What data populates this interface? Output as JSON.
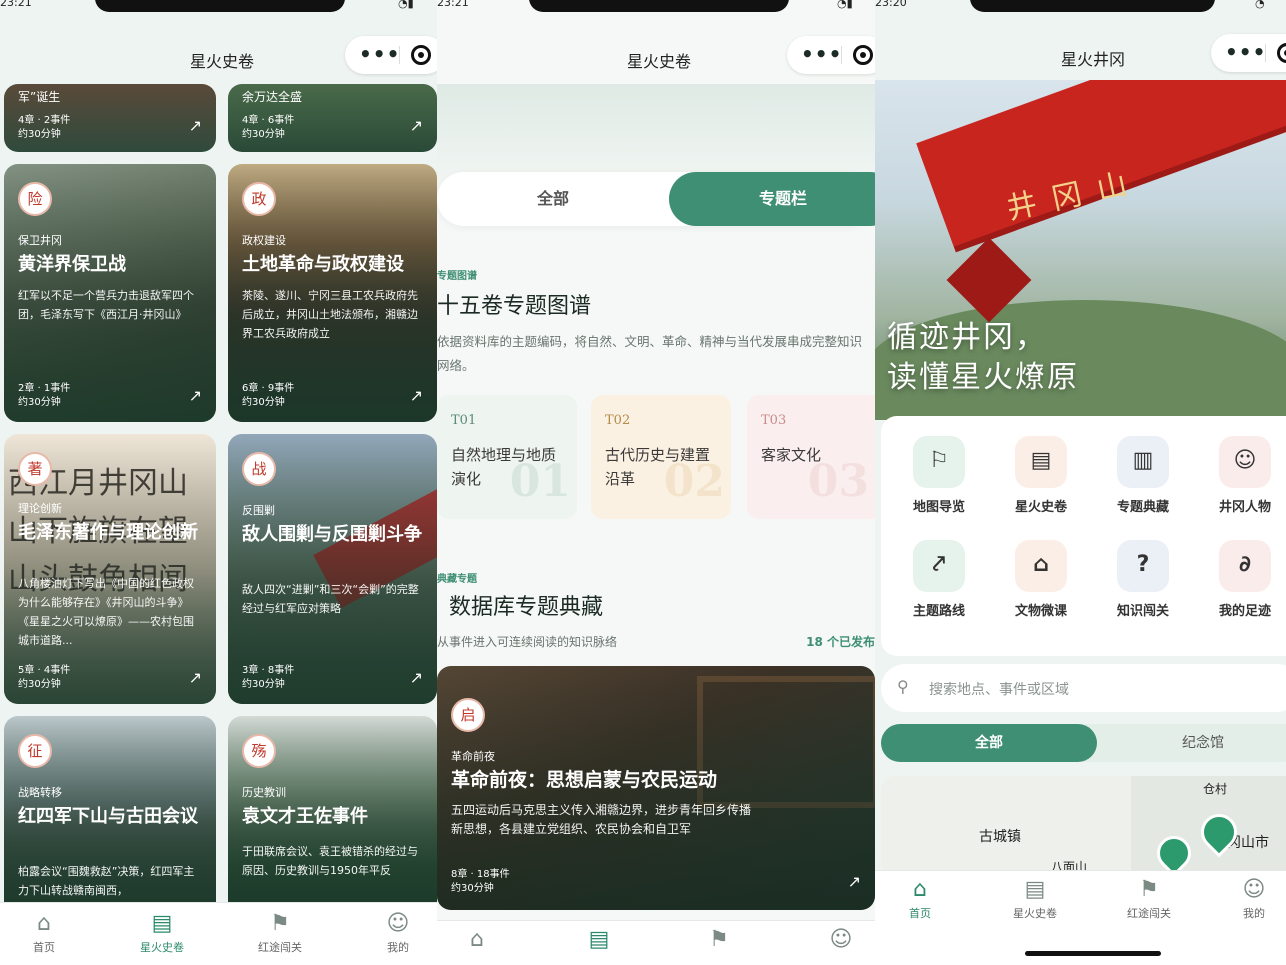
{
  "panel1": {
    "status": {
      "time": "23:21"
    },
    "title": "星火史卷",
    "top_cards": [
      {
        "title": "军”诞生",
        "meta": "4章 · 2事件",
        "time": "约30分钟"
      },
      {
        "title": "余万达全盛",
        "meta": "4章 · 6事件",
        "time": "约30分钟"
      }
    ],
    "cards": [
      {
        "badge": "险",
        "category": "保卫井冈",
        "title": "黄洋界保卫战",
        "desc": "红军以不足一个营兵力击退敌军四个团，毛泽东写下《西江月·井冈山》",
        "meta": "2章 · 1事件",
        "time": "约30分钟"
      },
      {
        "badge": "政",
        "category": "政权建设",
        "title": "土地革命与政权建设",
        "desc": "茶陵、遂川、宁冈三县工农兵政府先后成立，井冈山土地法颁布，湘赣边界工农兵政府成立",
        "meta": "6章 · 9事件",
        "time": "约30分钟"
      },
      {
        "badge": "著",
        "category": "理论创新",
        "title": "毛泽东著作与理论创新",
        "desc": "八角楼油灯下写出《中国的红色政权为什么能够存在》《井冈山的斗争》《星星之火可以燎原》——农村包围城市道路...",
        "meta": "5章 · 4事件",
        "time": "约30分钟"
      },
      {
        "badge": "战",
        "category": "反围剿",
        "title": "敌人围剿与反围剿斗争",
        "desc": "敌人四次“进剿”和三次“会剿”的完整经过与红军应对策略",
        "meta": "3章 · 8事件",
        "time": "约30分钟"
      },
      {
        "badge": "征",
        "category": "战略转移",
        "title": "红四军下山与古田会议",
        "desc": "柏露会议“围魏救赵”决策，红四军主力下山转战赣南闽西，",
        "meta": "",
        "time": ""
      },
      {
        "badge": "殇",
        "category": "历史教训",
        "title": "袁文才王佐事件",
        "desc": "于田联席会议、袁王被错杀的经过与原因、历史教训与1950年平反",
        "meta": "",
        "time": ""
      }
    ],
    "tabs": [
      {
        "label": "首页"
      },
      {
        "label": "星火史卷"
      },
      {
        "label": "红途闯关"
      },
      {
        "label": "我的"
      }
    ]
  },
  "panel2": {
    "status": {
      "time": "23:21"
    },
    "title": "星火史卷",
    "segments": {
      "all": "全部",
      "column": "专题栏"
    },
    "section1": {
      "tag": "专题图谱",
      "title": "十五卷专题图谱",
      "desc": "依据资料库的主题编码，将自然、文明、革命、精神与当代发展串成完整知识网络。"
    },
    "topics": [
      {
        "code": "T01",
        "name": "自然地理与地质演化",
        "num": "01"
      },
      {
        "code": "T02",
        "name": "古代历史与建置沿革",
        "num": "02"
      },
      {
        "code": "T03",
        "name": "客家文化",
        "num": "03"
      }
    ],
    "section2": {
      "tag": "典藏专题",
      "title": "数据库专题典藏",
      "desc": "从事件进入可连续阅读的知识脉络",
      "count": "18 个已发布"
    },
    "feature": {
      "badge": "启",
      "category": "革命前夜",
      "title": "革命前夜：思想启蒙与农民运动",
      "desc": "五四运动后马克思主义传入湘赣边界，进步青年回乡传播新思想，各县建立党组织、农民协会和自卫军",
      "meta": "8章 · 18事件",
      "time": "约30分钟"
    }
  },
  "panel3": {
    "status": {
      "time": "23:20"
    },
    "title": "星火井冈",
    "hero": {
      "line1": "循迹井冈，",
      "line2": "读懂星火燎原",
      "sign": "井冈山"
    },
    "grid": [
      {
        "label": "地图导览",
        "icon": "map-icon"
      },
      {
        "label": "星火史卷",
        "icon": "scroll-icon"
      },
      {
        "label": "专题典藏",
        "icon": "book-icon"
      },
      {
        "label": "井冈人物",
        "icon": "person-icon"
      },
      {
        "label": "主题路线",
        "icon": "route-icon"
      },
      {
        "label": "文物微课",
        "icon": "museum-icon"
      },
      {
        "label": "知识闯关",
        "icon": "shield-icon"
      },
      {
        "label": "我的足迹",
        "icon": "footprint-icon"
      }
    ],
    "search_placeholder": "搜索地点、事件或区域",
    "filters": {
      "all": "全部",
      "memorial": "纪念馆"
    },
    "map": {
      "labels": [
        "古城镇",
        "冈山市",
        "仓村",
        "八面山"
      ]
    },
    "tabs": [
      {
        "label": "首页"
      },
      {
        "label": "星火史卷"
      },
      {
        "label": "红途闯关"
      },
      {
        "label": "我的"
      }
    ]
  },
  "colors": {
    "accent": "#3f8f74",
    "badge_red": "#c0392b"
  }
}
